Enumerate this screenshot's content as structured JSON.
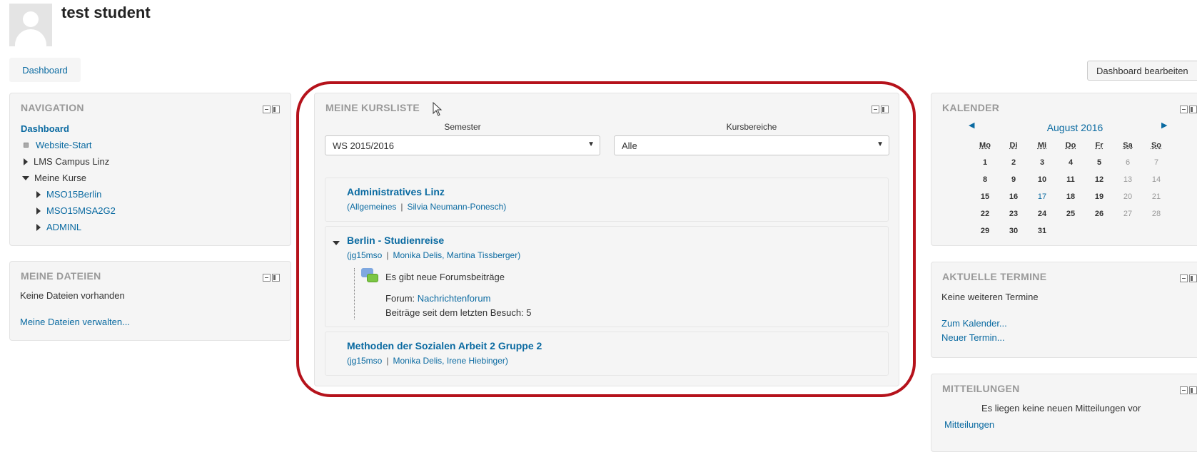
{
  "user": {
    "name": "test student"
  },
  "breadcrumb": {
    "dashboard_label": "Dashboard"
  },
  "header": {
    "edit_button_label": "Dashboard bearbeiten"
  },
  "navigation": {
    "title": "NAVIGATION",
    "dashboard": "Dashboard",
    "website_start": "Website-Start",
    "lms_campus": "LMS Campus Linz",
    "my_courses": "Meine Kurse",
    "courses": [
      "MSO15Berlin",
      "MSO15MSA2G2",
      "ADMINL"
    ]
  },
  "my_files": {
    "title": "MEINE DATEIEN",
    "empty_text": "Keine Dateien vorhanden",
    "manage_link": "Meine Dateien verwalten..."
  },
  "course_list": {
    "title": "MEINE KURSLISTE",
    "semester_label": "Semester",
    "semester_value": "WS 2015/2016",
    "area_label": "Kursbereiche",
    "area_value": "Alle",
    "courses": [
      {
        "title": "Administratives Linz",
        "meta_open": "(Allgemeines",
        "meta_sep": "|",
        "meta_people": "Silvia Neumann-Ponesch)"
      },
      {
        "title": "Berlin - Studienreise",
        "meta_open": "(jg15mso",
        "meta_sep": "|",
        "meta_people": "Monika Delis, Martina Tissberger)",
        "notice": "Es gibt neue Forumsbeiträge",
        "forum_prefix": "Forum:",
        "forum_link": "Nachrichtenforum",
        "posts_since": "Beiträge seit dem letzten Besuch: 5"
      },
      {
        "title": "Methoden der Sozialen Arbeit 2 Gruppe 2",
        "meta_open": "(jg15mso",
        "meta_sep": "|",
        "meta_people": "Monika Delis, Irene Hiebinger)"
      }
    ]
  },
  "calendar": {
    "title": "KALENDER",
    "month": "August 2016",
    "prev": "◀",
    "next": "▶",
    "weekdays": [
      "Mo",
      "Di",
      "Mi",
      "Do",
      "Fr",
      "Sa",
      "So"
    ],
    "weeks": [
      [
        "1",
        "2",
        "3",
        "4",
        "5",
        "6",
        "7"
      ],
      [
        "8",
        "9",
        "10",
        "11",
        "12",
        "13",
        "14"
      ],
      [
        "15",
        "16",
        "17",
        "18",
        "19",
        "20",
        "21"
      ],
      [
        "22",
        "23",
        "24",
        "25",
        "26",
        "27",
        "28"
      ],
      [
        "29",
        "30",
        "31",
        "",
        "",
        "",
        ""
      ]
    ],
    "today": "17"
  },
  "events": {
    "title": "AKTUELLE TERMINE",
    "empty_text": "Keine weiteren Termine",
    "calendar_link": "Zum Kalender...",
    "new_event_link": "Neuer Termin..."
  },
  "messages": {
    "title": "MITTEILUNGEN",
    "empty_text": "Es liegen keine neuen Mitteilungen vor",
    "link": "Mitteilungen"
  }
}
